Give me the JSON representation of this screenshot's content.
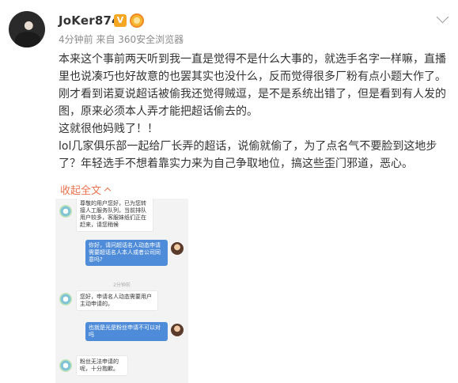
{
  "post": {
    "username": "JoKer874",
    "vip_badge": "V",
    "meta": "4分钟前 来自 360安全浏览器",
    "content_lines": [
      "本来这个事前两天听到我一直是觉得不是什么大事的，就选手名字一样嘛，直播",
      "里也说凑巧也好故意的也罢其实也没什么，反而觉得很多厂粉有点小题大作了。",
      "刚才看到诺夏说超话被偷我还觉得贼逗，是不是系统出错了，但是看到有人发的",
      "图，原来必须本人弄才能把超话偷去的。",
      "这就很他妈贱了！！",
      "lol几家俱乐部一起给厂长弄的超话，说偷就偷了，为了点名气不要脸到这地步",
      "了？年轻选手不想着靠实力来为自己争取地位，搞这些歪门邪道，恶心。"
    ],
    "collapse_label": "收起全文"
  },
  "screenshot": {
    "bubbles": [
      {
        "side": "in",
        "text": "尊敬的用户您好，已为您转接人工服务队列，当前排队用户较多，客服妹纸们正在赶来，请您稍候"
      },
      {
        "side": "out",
        "text": "你好，请问超话名人动态申请需要超话名人本人或者公司同意吗?"
      },
      {
        "side": "time",
        "text": "2分钟前"
      },
      {
        "side": "in",
        "text": "您好，申请名人动态需要用户主动申请的。"
      },
      {
        "side": "out",
        "text": "也就是光是粉丝申请不可以对吗"
      },
      {
        "side": "in",
        "text": "粉丝无法申请的呢，十分抱歉。"
      }
    ]
  }
}
